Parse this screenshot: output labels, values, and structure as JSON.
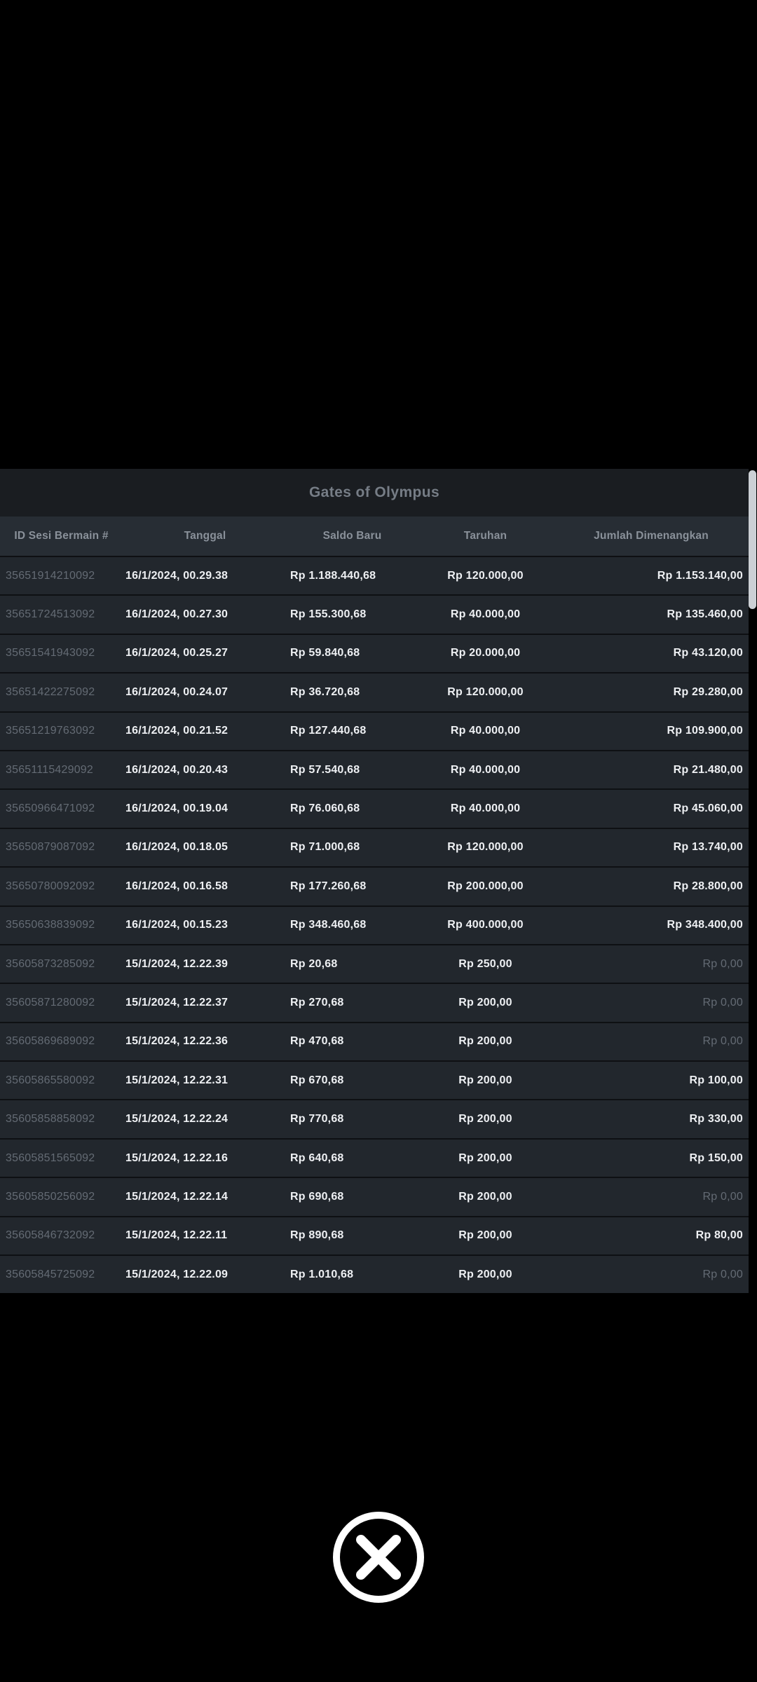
{
  "modal": {
    "title": "Gates of Olympus",
    "columns": [
      {
        "key": "id",
        "label": "ID Sesi Bermain #"
      },
      {
        "key": "tanggal",
        "label": "Tanggal"
      },
      {
        "key": "saldo",
        "label": "Saldo Baru"
      },
      {
        "key": "taruhan",
        "label": "Taruhan"
      },
      {
        "key": "jumlah",
        "label": "Jumlah Dimenangkan"
      }
    ],
    "rows": [
      {
        "id": "35651914210092",
        "tanggal": "16/1/2024, 00.29.38",
        "saldo": "Rp 1.188.440,68",
        "taruhan": "Rp 120.000,00",
        "jumlah": "Rp 1.153.140,00"
      },
      {
        "id": "35651724513092",
        "tanggal": "16/1/2024, 00.27.30",
        "saldo": "Rp 155.300,68",
        "taruhan": "Rp 40.000,00",
        "jumlah": "Rp 135.460,00"
      },
      {
        "id": "35651541943092",
        "tanggal": "16/1/2024, 00.25.27",
        "saldo": "Rp 59.840,68",
        "taruhan": "Rp 20.000,00",
        "jumlah": "Rp 43.120,00"
      },
      {
        "id": "35651422275092",
        "tanggal": "16/1/2024, 00.24.07",
        "saldo": "Rp 36.720,68",
        "taruhan": "Rp 120.000,00",
        "jumlah": "Rp 29.280,00"
      },
      {
        "id": "35651219763092",
        "tanggal": "16/1/2024, 00.21.52",
        "saldo": "Rp 127.440,68",
        "taruhan": "Rp 40.000,00",
        "jumlah": "Rp 109.900,00"
      },
      {
        "id": "35651115429092",
        "tanggal": "16/1/2024, 00.20.43",
        "saldo": "Rp 57.540,68",
        "taruhan": "Rp 40.000,00",
        "jumlah": "Rp 21.480,00"
      },
      {
        "id": "35650966471092",
        "tanggal": "16/1/2024, 00.19.04",
        "saldo": "Rp 76.060,68",
        "taruhan": "Rp 40.000,00",
        "jumlah": "Rp 45.060,00"
      },
      {
        "id": "35650879087092",
        "tanggal": "16/1/2024, 00.18.05",
        "saldo": "Rp 71.000,68",
        "taruhan": "Rp 120.000,00",
        "jumlah": "Rp 13.740,00"
      },
      {
        "id": "35650780092092",
        "tanggal": "16/1/2024, 00.16.58",
        "saldo": "Rp 177.260,68",
        "taruhan": "Rp 200.000,00",
        "jumlah": "Rp 28.800,00"
      },
      {
        "id": "35650638839092",
        "tanggal": "16/1/2024, 00.15.23",
        "saldo": "Rp 348.460,68",
        "taruhan": "Rp 400.000,00",
        "jumlah": "Rp 348.400,00"
      },
      {
        "id": "35605873285092",
        "tanggal": "15/1/2024, 12.22.39",
        "saldo": "Rp 20,68",
        "taruhan": "Rp 250,00",
        "jumlah": "Rp 0,00"
      },
      {
        "id": "35605871280092",
        "tanggal": "15/1/2024, 12.22.37",
        "saldo": "Rp 270,68",
        "taruhan": "Rp 200,00",
        "jumlah": "Rp 0,00"
      },
      {
        "id": "35605869689092",
        "tanggal": "15/1/2024, 12.22.36",
        "saldo": "Rp 470,68",
        "taruhan": "Rp 200,00",
        "jumlah": "Rp 0,00"
      },
      {
        "id": "35605865580092",
        "tanggal": "15/1/2024, 12.22.31",
        "saldo": "Rp 670,68",
        "taruhan": "Rp 200,00",
        "jumlah": "Rp 100,00"
      },
      {
        "id": "35605858858092",
        "tanggal": "15/1/2024, 12.22.24",
        "saldo": "Rp 770,68",
        "taruhan": "Rp 200,00",
        "jumlah": "Rp 330,00"
      },
      {
        "id": "35605851565092",
        "tanggal": "15/1/2024, 12.22.16",
        "saldo": "Rp 640,68",
        "taruhan": "Rp 200,00",
        "jumlah": "Rp 150,00"
      },
      {
        "id": "35605850256092",
        "tanggal": "15/1/2024, 12.22.14",
        "saldo": "Rp 690,68",
        "taruhan": "Rp 200,00",
        "jumlah": "Rp 0,00"
      },
      {
        "id": "35605846732092",
        "tanggal": "15/1/2024, 12.22.11",
        "saldo": "Rp 890,68",
        "taruhan": "Rp 200,00",
        "jumlah": "Rp 80,00"
      },
      {
        "id": "35605845725092",
        "tanggal": "15/1/2024, 12.22.09",
        "saldo": "Rp 1.010,68",
        "taruhan": "Rp 200,00",
        "jumlah": "Rp 0,00"
      }
    ],
    "zero_win_value": "Rp 0,00"
  },
  "close_button": {
    "icon": "x-circle"
  },
  "colors": {
    "page_bg": "#000000",
    "modal_bg": "#1a1d21",
    "header_row_bg": "#272d34",
    "row_bg": "#22272d",
    "row_separator": "#0e1013",
    "text_primary": "#eef0f3",
    "text_muted": "#646b74",
    "header_text": "#8a919a",
    "title_text": "#767d86",
    "scrollbar_thumb": "#ccd0d5",
    "close_icon": "#ffffff"
  }
}
